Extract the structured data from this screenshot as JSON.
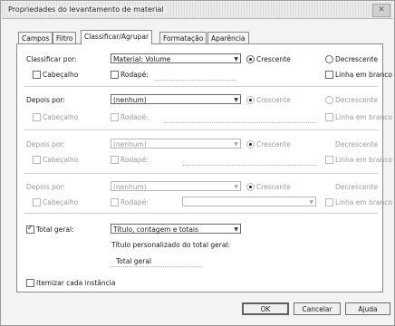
{
  "window": {
    "title": "Propriedades do levantamento de material",
    "close_glyph": "✕"
  },
  "tabs": [
    {
      "label": "Campos"
    },
    {
      "label": "Filtro"
    },
    {
      "label": "Classificar/Agrupar",
      "active": true
    },
    {
      "label": "Formatação"
    },
    {
      "label": "Aparência"
    }
  ],
  "sort_rows": [
    {
      "label": "Classificar por:",
      "value": "Material: Volume",
      "asc": "Crescente",
      "desc": "Decrescente",
      "header": "Cabeçalho",
      "footer": "Rodapé:",
      "blank": "Linha em branco",
      "enabled": true
    },
    {
      "label": "Depois por:",
      "value": "(nenhum)",
      "asc": "Crescente",
      "desc": "Decrescente",
      "header": "Cabeçalho",
      "footer": "Rodapé:",
      "blank": "Linha em branco",
      "enabled": true
    },
    {
      "label": "Depois por:",
      "value": "(nenhum)",
      "asc": "Crescente",
      "desc": "Decrescente",
      "header": "Cabeçalho",
      "footer": "Rodapé:",
      "blank": "Linha em branco",
      "enabled": false
    },
    {
      "label": "Depois por:",
      "value": "(nenhum)",
      "asc": "Crescente",
      "desc": "Decrescente",
      "header": "Cabeçalho",
      "footer": "Rodapé:",
      "blank": "Linha em branco",
      "enabled": false
    }
  ],
  "grand_total": {
    "label": "Total geral:",
    "checked": true,
    "value": "Título, contagem e totais",
    "custom_title_label": "Título personalizado do total geral:",
    "custom_title_value": "Total geral"
  },
  "itemize": {
    "label": "Itemizar cada instância",
    "checked": false
  },
  "buttons": {
    "ok": "OK",
    "cancel": "Cancelar",
    "help": "Ajuda"
  }
}
